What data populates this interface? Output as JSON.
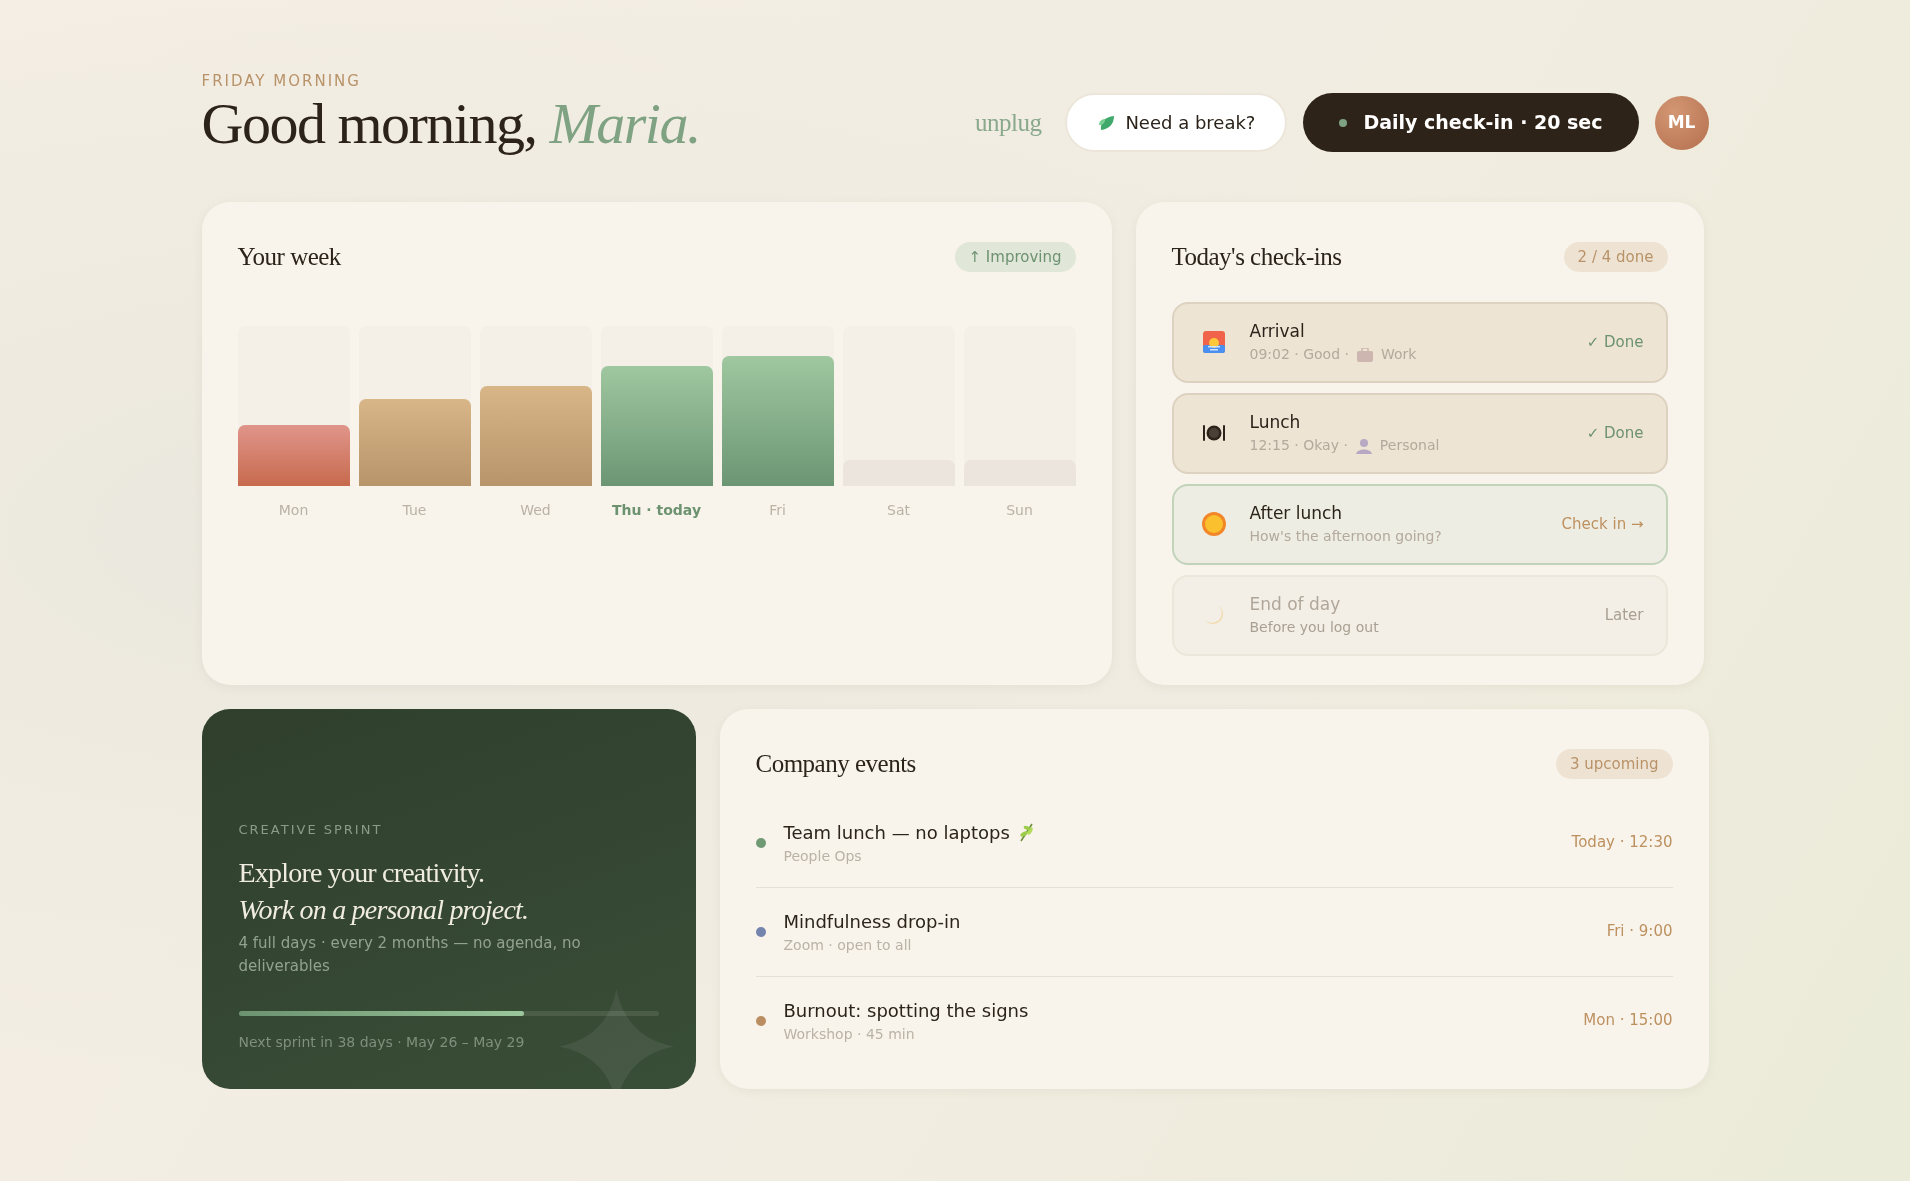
{
  "header": {
    "eyebrow": "FRIDAY MORNING",
    "greeting": "Good morning,",
    "name": "Maria.",
    "brand": "unplug",
    "break_button": "Need a break?",
    "checkin_button": "Daily check-in · 20 sec",
    "avatar": "ML"
  },
  "week": {
    "title": "Your week",
    "badge": "↑ Improving",
    "days": [
      {
        "label": "Mon",
        "kind": "low",
        "level": 0.38,
        "selected": false
      },
      {
        "label": "Tue",
        "kind": "mid",
        "level": 0.54,
        "selected": false
      },
      {
        "label": "Wed",
        "kind": "mid",
        "level": 0.62,
        "selected": false
      },
      {
        "label": "Thu · today",
        "kind": "high",
        "level": 0.75,
        "selected": true
      },
      {
        "label": "Fri",
        "kind": "high",
        "level": 0.81,
        "selected": false
      },
      {
        "label": "Sat",
        "kind": "empty",
        "level": 0.16,
        "selected": false
      },
      {
        "label": "Sun",
        "kind": "empty",
        "level": 0.16,
        "selected": false
      }
    ]
  },
  "checkins": {
    "title": "Today's check-ins",
    "badge": "2 / 4 done",
    "items": [
      {
        "kind": "done",
        "title": "Arrival",
        "detail": "09:02 · Good ·",
        "tag": "Work",
        "status": "✓ Done"
      },
      {
        "kind": "done",
        "title": "Lunch",
        "detail": "12:15 · Okay ·",
        "tag": "Personal",
        "status": "✓ Done"
      },
      {
        "kind": "current",
        "title": "After lunch",
        "detail": "How's the afternoon going?",
        "status": "Check in →"
      },
      {
        "kind": "later",
        "title": "End of day",
        "detail": "Before you log out",
        "status": "Later"
      }
    ]
  },
  "sprint": {
    "eyebrow": "CREATIVE SPRINT",
    "line1": "Explore your creativity.",
    "line2": "Work on a personal project.",
    "description": "4 full days · every 2 months — no agenda, no deliverables",
    "level": 0.68,
    "footer": "Next sprint in 38 days · May 26 – May 29"
  },
  "events": {
    "title": "Company events",
    "badge": "3 upcoming",
    "items": [
      {
        "title": "Team lunch — no laptops",
        "has_leaf": true,
        "subtitle": "People Ops",
        "when": "Today · 12:30",
        "color": "#6f9a74"
      },
      {
        "title": "Mindfulness drop-in",
        "has_leaf": false,
        "subtitle": "Zoom · open to all",
        "when": "Fri · 9:00",
        "color": "#7384ad"
      },
      {
        "title": "Burnout: spotting the signs",
        "has_leaf": false,
        "subtitle": "Workshop · 45 min",
        "when": "Mon · 15:00",
        "color": "#bb8e62"
      }
    ]
  }
}
